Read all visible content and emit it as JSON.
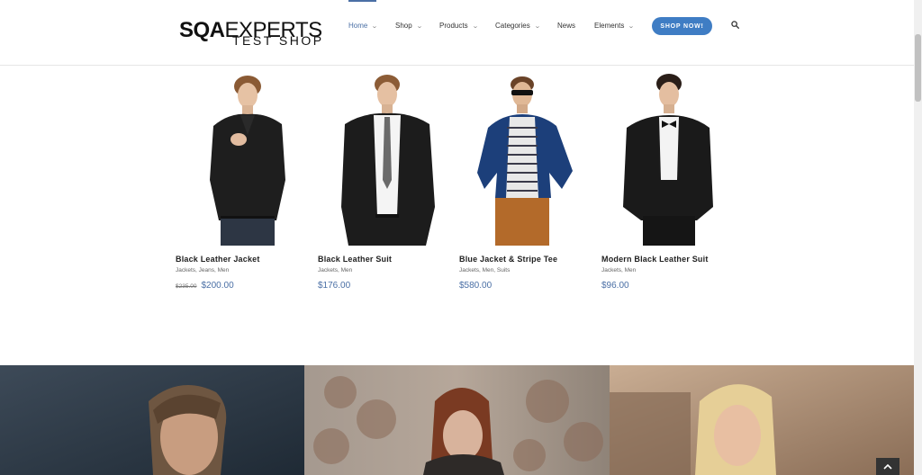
{
  "header": {
    "logo": {
      "part1": "SQA",
      "part2": "EXPERTS",
      "tagline": "TEST SHOP"
    },
    "nav": [
      {
        "label": "Home",
        "active": true,
        "dropdown": true
      },
      {
        "label": "Shop",
        "dropdown": true
      },
      {
        "label": "Products",
        "dropdown": true
      },
      {
        "label": "Categories",
        "dropdown": true
      },
      {
        "label": "News",
        "dropdown": false
      },
      {
        "label": "Elements",
        "dropdown": true
      }
    ],
    "cta_label": "SHOP NOW!",
    "accent_color": "#4a6fa5",
    "cta_color": "#3f7dc4"
  },
  "products": [
    {
      "name": "Black Leather Jacket",
      "categories": "Jackets, Jeans, Men",
      "old_price": "$235.00",
      "price": "$200.00"
    },
    {
      "name": "Black Leather Suit",
      "categories": "Jackets, Men",
      "price": "$176.00"
    },
    {
      "name": "Blue Jacket & Stripe Tee",
      "categories": "Jackets, Men, Suits",
      "price": "$580.00"
    },
    {
      "name": "Modern Black Leather Suit",
      "categories": "Jackets, Men",
      "price": "$96.00"
    }
  ],
  "icons": {
    "search": "search-icon",
    "chevron": "chevron-down-icon",
    "to_top": "chevron-up-icon"
  }
}
